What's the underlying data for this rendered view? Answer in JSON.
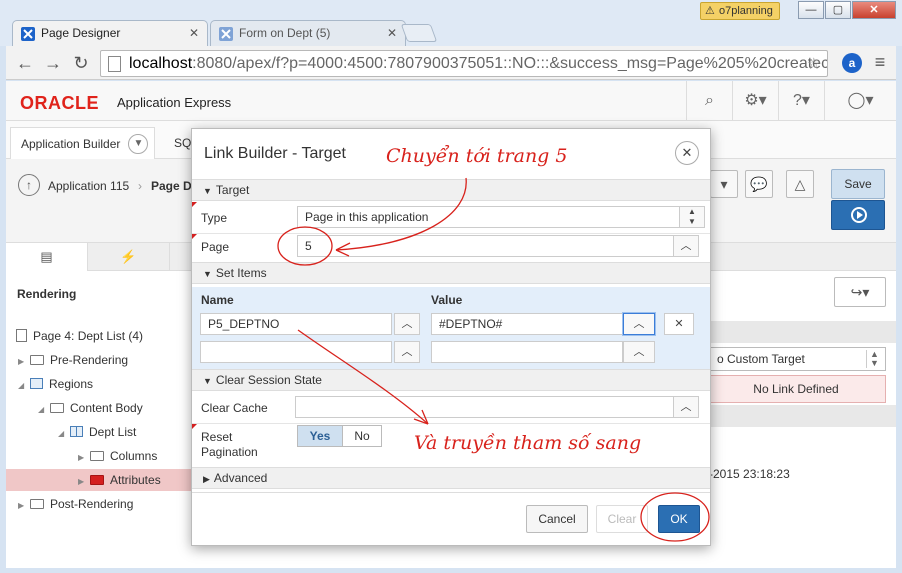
{
  "browser": {
    "tabs": [
      {
        "title": "Page Designer",
        "active": true
      },
      {
        "title": "Form on Dept (5)",
        "active": false
      }
    ],
    "profile": "o7planning",
    "url_host": "localhost",
    "url_rest": ":8080/apex/f?p=4000:4500:7807900375051::NO:::&success_msg=Page%205%20createc"
  },
  "apex": {
    "brand": "ORACLE",
    "product": "Application Express",
    "nav_tab": "Application Builder",
    "nav_tab_partial": "SQ",
    "breadcrumb": [
      "Application 115",
      "Page D"
    ],
    "save_label": "Save",
    "rendering_label": "Rendering",
    "tree": [
      {
        "label": "Page 4: Dept List (4)",
        "level": 0,
        "icon": "page"
      },
      {
        "label": "Pre-Rendering",
        "level": 1,
        "icon": "folder"
      },
      {
        "label": "Regions",
        "level": 1,
        "icon": "region"
      },
      {
        "label": "Content Body",
        "level": 2,
        "icon": "folder"
      },
      {
        "label": "Dept List",
        "level": 3,
        "icon": "grid"
      },
      {
        "label": "Columns",
        "level": 4,
        "icon": "folder"
      },
      {
        "label": "Attributes",
        "level": 4,
        "icon": "folder-red",
        "selected": true
      },
      {
        "label": "Post-Rendering",
        "level": 0,
        "icon": "folder"
      }
    ],
    "right_custom_target": "o Custom Target",
    "right_no_link": "No Link Defined",
    "right_date": "-2015 23:18:23"
  },
  "modal": {
    "title": "Link Builder - Target",
    "target_section": "Target",
    "type_label": "Type",
    "type_value": "Page in this application",
    "page_label": "Page",
    "page_value": "5",
    "set_items_section": "Set Items",
    "name_header": "Name",
    "value_header": "Value",
    "item1_name": "P5_DEPTNO",
    "item1_value": "#DEPTNO#",
    "clear_session_section": "Clear Session State",
    "clear_cache_label": "Clear Cache",
    "reset_pagination_label": "Reset Pagination",
    "yes_label": "Yes",
    "no_label": "No",
    "advanced_section": "Advanced",
    "cancel_label": "Cancel",
    "clear_label": "Clear",
    "ok_label": "OK"
  },
  "annotations": {
    "note_top": "Chuyển tới trang 5",
    "note_bottom": "Và truyền tham số sang"
  },
  "colors": {
    "oracle_red": "#e0231b",
    "apex_blue": "#2b6fb3",
    "annotation_red": "#d8221c"
  }
}
